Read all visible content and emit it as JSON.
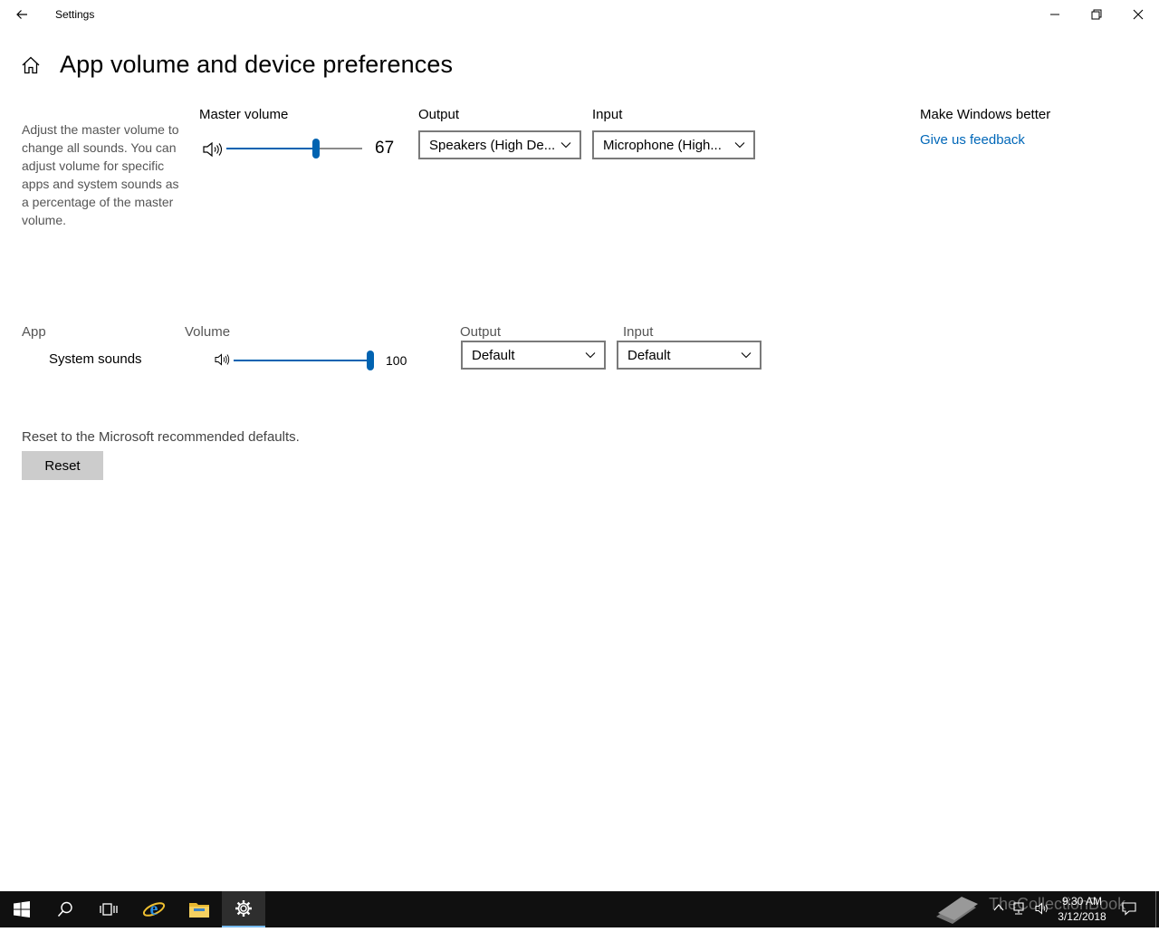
{
  "window": {
    "title": "Settings"
  },
  "page": {
    "title": "App volume and device preferences",
    "description": "Adjust the master volume to change all sounds. You can adjust volume for specific apps and system sounds as a percentage of the master volume."
  },
  "master": {
    "label": "Master volume",
    "value": "67",
    "level": 0.67,
    "output_label": "Output",
    "output_value": "Speakers (High De...",
    "input_label": "Input",
    "input_value": "Microphone (High..."
  },
  "feedback": {
    "heading": "Make Windows better",
    "link": "Give us feedback"
  },
  "apps": {
    "col_app": "App",
    "col_volume": "Volume",
    "col_output": "Output",
    "col_input": "Input",
    "rows": [
      {
        "name": "System sounds",
        "volume": "100",
        "level": 1.0,
        "output": "Default",
        "input": "Default"
      }
    ]
  },
  "reset": {
    "text": "Reset to the Microsoft recommended defaults.",
    "button": "Reset"
  },
  "taskbar": {
    "time": "9:30 AM",
    "date": "3/12/2018",
    "watermark": "TheCollectionBook"
  },
  "colors": {
    "accent": "#0063b1",
    "link": "#0067b8",
    "taskbar": "#101010"
  }
}
